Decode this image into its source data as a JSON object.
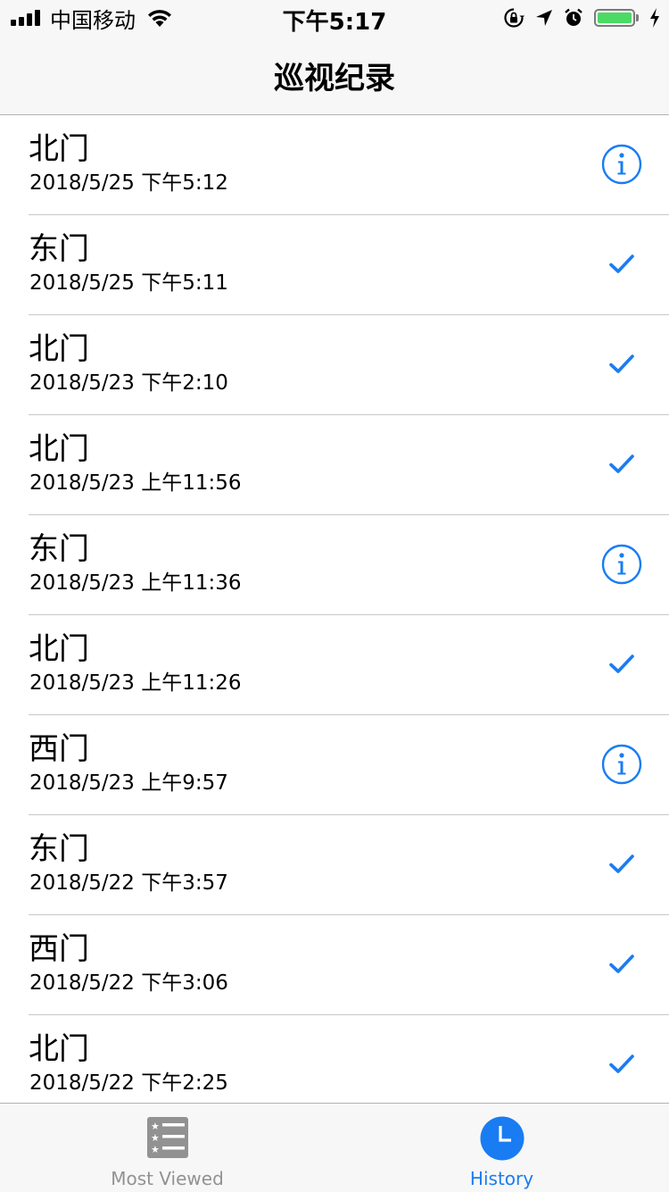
{
  "status_bar": {
    "carrier": "中国移动",
    "time": "下午5:17",
    "icons": [
      "signal-icon",
      "wifi-icon",
      "orientation-lock-icon",
      "location-arrow-icon",
      "alarm-icon",
      "battery-icon",
      "charging-bolt-icon"
    ]
  },
  "nav": {
    "title": "巡视纪录"
  },
  "colors": {
    "accent": "#1a7cf2",
    "battery": "#4cd964",
    "inactive_tab": "#929292"
  },
  "records": [
    {
      "gate": "北门",
      "time": "2018/5/25 下午5:12",
      "status": "info"
    },
    {
      "gate": "东门",
      "time": "2018/5/25 下午5:11",
      "status": "check"
    },
    {
      "gate": "北门",
      "time": "2018/5/23 下午2:10",
      "status": "check"
    },
    {
      "gate": "北门",
      "time": "2018/5/23 上午11:56",
      "status": "check"
    },
    {
      "gate": "东门",
      "time": "2018/5/23 上午11:36",
      "status": "info"
    },
    {
      "gate": "北门",
      "time": "2018/5/23 上午11:26",
      "status": "check"
    },
    {
      "gate": "西门",
      "time": "2018/5/23 上午9:57",
      "status": "info"
    },
    {
      "gate": "东门",
      "time": "2018/5/22 下午3:57",
      "status": "check"
    },
    {
      "gate": "西门",
      "time": "2018/5/22 下午3:06",
      "status": "check"
    },
    {
      "gate": "北门",
      "time": "2018/5/22 下午2:25",
      "status": "check"
    }
  ],
  "tabs": [
    {
      "label": "Most Viewed",
      "icon": "most-viewed-list-icon",
      "selected": false
    },
    {
      "label": "History",
      "icon": "history-clock-icon",
      "selected": true
    }
  ]
}
